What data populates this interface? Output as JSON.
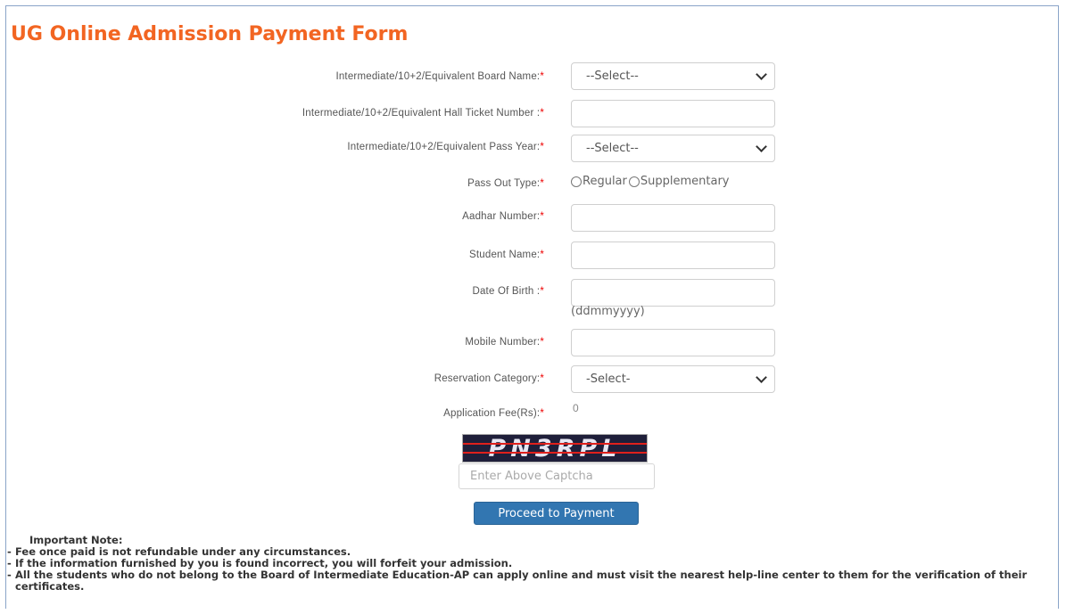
{
  "form": {
    "title": "UG Online Admission Payment Form",
    "required_mark": "*",
    "board": {
      "label": "Intermediate/10+2/Equivalent Board Name:",
      "value": "--Select--"
    },
    "hall_ticket": {
      "label": "Intermediate/10+2/Equivalent Hall Ticket Number :",
      "value": ""
    },
    "pass_year": {
      "label": "Intermediate/10+2/Equivalent Pass Year:",
      "value": "--Select--"
    },
    "pass_out_type": {
      "label": "Pass Out Type:",
      "options": [
        "Regular",
        "Supplementary"
      ]
    },
    "aadhar": {
      "label": "Aadhar Number:",
      "value": ""
    },
    "student_name": {
      "label": "Student Name:",
      "value": ""
    },
    "dob": {
      "label": "Date Of Birth :",
      "value": "",
      "hint": "(ddmmyyyy)"
    },
    "mobile": {
      "label": "Mobile Number:",
      "value": ""
    },
    "category": {
      "label": "Reservation Category:",
      "value": "-Select-"
    },
    "fee": {
      "label": "Application Fee(Rs):",
      "value": "0"
    },
    "captcha": {
      "image_text": "PN3RPL",
      "placeholder": "Enter Above Captcha"
    },
    "submit_label": "Proceed to Payment"
  },
  "notes": {
    "heading": "Important Note:",
    "items": [
      "Fee once paid is not refundable under any circumstances.",
      "If the information furnished by you is found incorrect, you will forfeit your admission.",
      "All the students who do not belong to the Board of Intermediate Education-AP can apply online and must visit the nearest help-line center to them for the verification of their certificates."
    ]
  },
  "colors": {
    "title": "#f26522",
    "button": "#3276b1",
    "required": "#ee0000",
    "frame_border": "#8aa4c8"
  },
  "icons": {
    "dropdown": "chevron-down-icon",
    "radio": "radio-unchecked-icon"
  }
}
